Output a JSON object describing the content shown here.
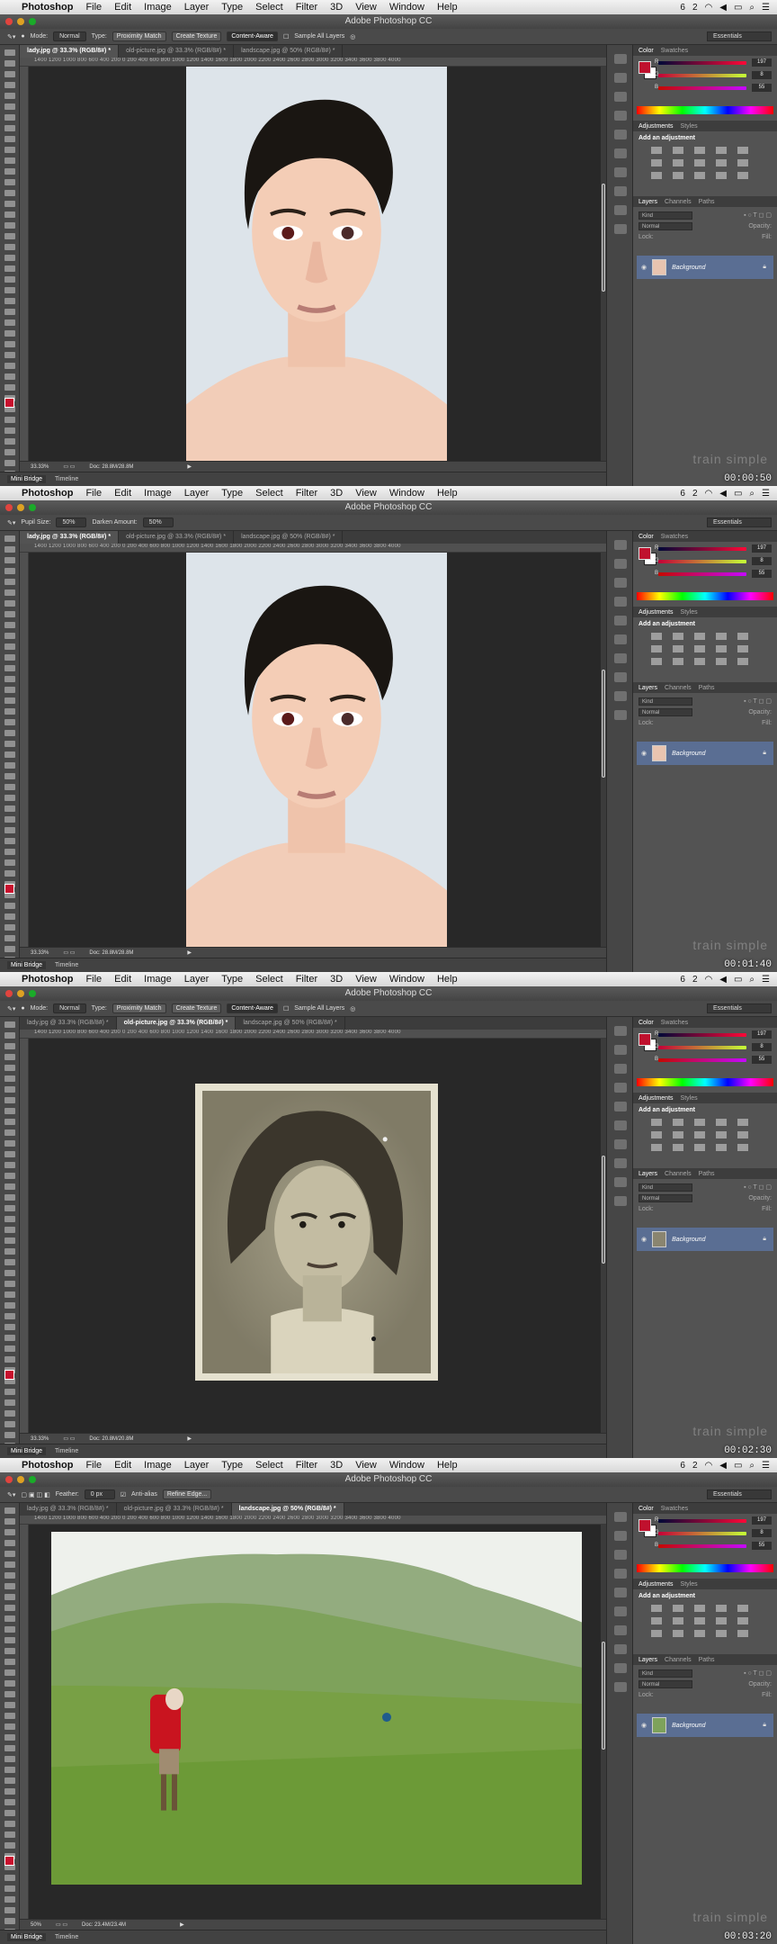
{
  "menubar": {
    "app_name": "Photoshop",
    "items": [
      "File",
      "Edit",
      "Image",
      "Layer",
      "Type",
      "Select",
      "Filter",
      "3D",
      "View",
      "Window",
      "Help"
    ],
    "status_icons": [
      "6",
      "2"
    ]
  },
  "window_title": "Adobe Photoshop CC",
  "workspace": "Essentials",
  "tabs": [
    "lady.jpg @ 33.3% (RGB/8#) *",
    "old-picture.jpg @ 33.3% (RGB/8#) *",
    "landscape.jpg @ 50% (RGB/8#) *"
  ],
  "ruler_text": "1400 1200 1000 800 600 400 200 0 200 400 600 800 1000 1200 1400 1600 1800 2000 2200 2400 2600 2800 3000 3200 3400 3600 3800 4000",
  "panels": {
    "color_tabs": [
      "Color",
      "Swatches"
    ],
    "color_values": {
      "r": "197",
      "g": "8",
      "b": "55"
    },
    "adjust_tabs": [
      "Adjustments",
      "Styles"
    ],
    "add_adjustment": "Add an adjustment",
    "layer_tabs": [
      "Layers",
      "Channels",
      "Paths"
    ],
    "kind": "Kind",
    "blend": "Normal",
    "opacity_label": "Opacity:",
    "lock_label": "Lock:",
    "fill_label": "Fill:",
    "layer_name": "Background"
  },
  "minibar": [
    "Mini Bridge",
    "Timeline"
  ],
  "watermark": "train simple",
  "shots": [
    {
      "options": {
        "mode_label": "Mode:",
        "mode_value": "Normal",
        "type_label": "Type:",
        "btn1": "Proximity Match",
        "btn2": "Create Texture",
        "btn3": "Content-Aware",
        "sample": "Sample All Layers"
      },
      "active_tab": 0,
      "zoom": "33.33%",
      "doc": "Doc: 28.8M/28.8M",
      "timecode": "00:00:50"
    },
    {
      "options": {
        "pupil_label": "Pupil Size:",
        "pupil_value": "50%",
        "darken_label": "Darken Amount:",
        "darken_value": "50%"
      },
      "active_tab": 0,
      "zoom": "33.33%",
      "doc": "Doc: 28.8M/28.8M",
      "timecode": "00:01:40"
    },
    {
      "options": {
        "mode_label": "Mode:",
        "mode_value": "Normal",
        "type_label": "Type:",
        "btn1": "Proximity Match",
        "btn2": "Create Texture",
        "btn3": "Content-Aware",
        "sample": "Sample All Layers"
      },
      "active_tab": 1,
      "zoom": "33.33%",
      "doc": "Doc: 20.8M/20.8M",
      "timecode": "00:02:30"
    },
    {
      "options": {
        "feather_label": "Feather:",
        "feather_value": "0 px",
        "antialias": "Anti-alias",
        "refine": "Refine Edge..."
      },
      "active_tab": 2,
      "zoom": "50%",
      "doc": "Doc: 23.4M/23.4M",
      "timecode": "00:03:20"
    }
  ]
}
